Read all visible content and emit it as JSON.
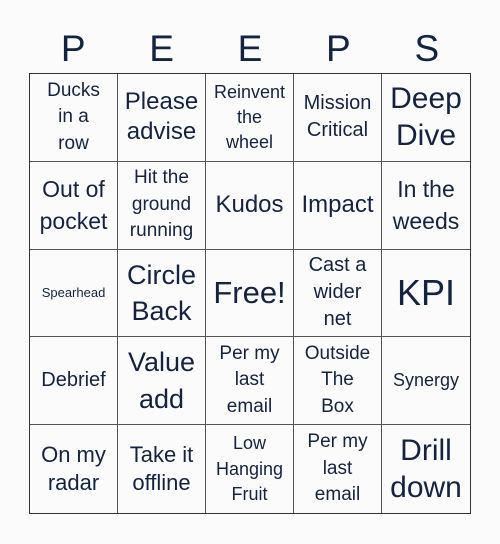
{
  "title_letters": [
    "P",
    "E",
    "E",
    "P",
    "S"
  ],
  "cells": [
    {
      "text": "Ducks in a row",
      "lines": [
        "Ducks",
        "in a",
        "row"
      ]
    },
    {
      "text": "Please advise",
      "lines": [
        "Please",
        "advise"
      ]
    },
    {
      "text": "Reinvent the wheel",
      "lines": [
        "Reinvent",
        "the",
        "wheel"
      ]
    },
    {
      "text": "Mission Critical",
      "lines": [
        "Mission",
        "Critical"
      ]
    },
    {
      "text": "Deep Dive",
      "lines": [
        "Deep",
        "Dive"
      ]
    },
    {
      "text": "Out of pocket",
      "lines": [
        "Out of",
        "pocket"
      ]
    },
    {
      "text": "Hit the ground running",
      "lines": [
        "Hit the",
        "ground",
        "running"
      ]
    },
    {
      "text": "Kudos",
      "lines": [
        "Kudos"
      ]
    },
    {
      "text": "Impact",
      "lines": [
        "Impact"
      ]
    },
    {
      "text": "In the weeds",
      "lines": [
        "In the",
        "weeds"
      ]
    },
    {
      "text": "Spearhead",
      "lines": [
        "Spearhead"
      ]
    },
    {
      "text": "Circle Back",
      "lines": [
        "Circle",
        "Back"
      ]
    },
    {
      "text": "Free!",
      "lines": [
        "Free!"
      ]
    },
    {
      "text": "Cast a wider net",
      "lines": [
        "Cast a",
        "wider",
        "net"
      ]
    },
    {
      "text": "KPI",
      "lines": [
        "KPI"
      ]
    },
    {
      "text": "Debrief",
      "lines": [
        "Debrief"
      ]
    },
    {
      "text": "Value add",
      "lines": [
        "Value",
        "add"
      ]
    },
    {
      "text": "Per my last email",
      "lines": [
        "Per my",
        "last",
        "email"
      ]
    },
    {
      "text": "Outside The Box",
      "lines": [
        "Outside",
        "The",
        "Box"
      ]
    },
    {
      "text": "Synergy",
      "lines": [
        "Synergy"
      ]
    },
    {
      "text": "On my radar",
      "lines": [
        "On my",
        "radar"
      ]
    },
    {
      "text": "Take it offline",
      "lines": [
        "Take it",
        "offline"
      ]
    },
    {
      "text": "Low Hanging Fruit",
      "lines": [
        "Low",
        "Hanging",
        "Fruit"
      ]
    },
    {
      "text": "Per my last email",
      "lines": [
        "Per my",
        "last",
        "email"
      ]
    },
    {
      "text": "Drill down",
      "lines": [
        "Drill",
        "down"
      ]
    }
  ]
}
